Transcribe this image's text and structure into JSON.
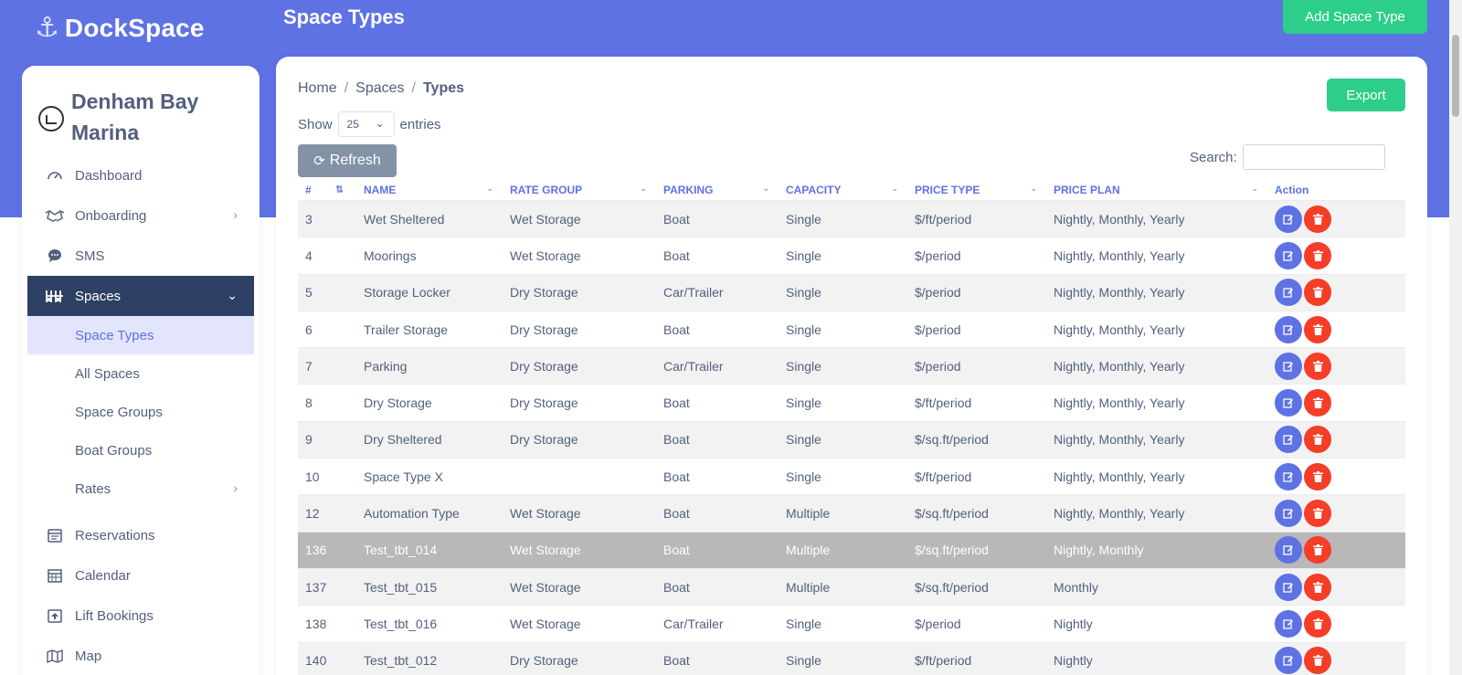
{
  "app": {
    "brand": "DockSpace",
    "page_title": "Space Types",
    "add_button": "Add Space Type"
  },
  "colors": {
    "primary": "#5e72e4",
    "success": "#2dce89",
    "danger": "#f53d28",
    "sidebar_active": "#2e4063"
  },
  "sidebar": {
    "org_name": "Denham Bay Marina",
    "items": [
      {
        "label": "Dashboard",
        "icon": "gauge-icon"
      },
      {
        "label": "Onboarding",
        "icon": "handshake-icon",
        "has_children": true
      },
      {
        "label": "SMS",
        "icon": "chat-icon"
      },
      {
        "label": "Spaces",
        "icon": "spaces-icon",
        "has_children": true,
        "active": true
      },
      {
        "label": "Reservations",
        "icon": "reservations-icon"
      },
      {
        "label": "Calendar",
        "icon": "calendar-icon"
      },
      {
        "label": "Lift Bookings",
        "icon": "lift-icon"
      },
      {
        "label": "Map",
        "icon": "map-icon"
      }
    ],
    "space_subitems": [
      {
        "label": "Space Types",
        "active": true
      },
      {
        "label": "All Spaces"
      },
      {
        "label": "Space Groups"
      },
      {
        "label": "Boat Groups"
      },
      {
        "label": "Rates",
        "has_children": true
      }
    ]
  },
  "breadcrumb": {
    "home": "Home",
    "spaces": "Spaces",
    "current": "Types"
  },
  "toolbar": {
    "export": "Export",
    "show": "Show",
    "entries_value": "25",
    "entries": "entries",
    "refresh": "Refresh",
    "search_label": "Search:",
    "search_value": ""
  },
  "table": {
    "headers": {
      "id": "#",
      "name": "NAME",
      "rate_group": "RATE GROUP",
      "parking": "PARKING",
      "capacity": "CAPACITY",
      "price_type": "PRICE TYPE",
      "price_plan": "PRICE PLAN",
      "action": "Action"
    },
    "rows": [
      {
        "id": "3",
        "name": "Wet Sheltered",
        "rate_group": "Wet Storage",
        "parking": "Boat",
        "capacity": "Single",
        "price_type": "$/ft/period",
        "price_plan": "Nightly, Monthly, Yearly"
      },
      {
        "id": "4",
        "name": "Moorings",
        "rate_group": "Wet Storage",
        "parking": "Boat",
        "capacity": "Single",
        "price_type": "$/period",
        "price_plan": "Nightly, Monthly, Yearly"
      },
      {
        "id": "5",
        "name": "Storage Locker",
        "rate_group": "Dry Storage",
        "parking": "Car/Trailer",
        "capacity": "Single",
        "price_type": "$/period",
        "price_plan": "Nightly, Monthly, Yearly"
      },
      {
        "id": "6",
        "name": "Trailer Storage",
        "rate_group": "Dry Storage",
        "parking": "Boat",
        "capacity": "Single",
        "price_type": "$/period",
        "price_plan": "Nightly, Monthly, Yearly"
      },
      {
        "id": "7",
        "name": "Parking",
        "rate_group": "Dry Storage",
        "parking": "Car/Trailer",
        "capacity": "Single",
        "price_type": "$/period",
        "price_plan": "Nightly, Monthly, Yearly"
      },
      {
        "id": "8",
        "name": "Dry Storage",
        "rate_group": "Dry Storage",
        "parking": "Boat",
        "capacity": "Single",
        "price_type": "$/ft/period",
        "price_plan": "Nightly, Monthly, Yearly"
      },
      {
        "id": "9",
        "name": "Dry Sheltered",
        "rate_group": "Dry Storage",
        "parking": "Boat",
        "capacity": "Single",
        "price_type": "$/sq.ft/period",
        "price_plan": "Nightly, Monthly, Yearly"
      },
      {
        "id": "10",
        "name": "Space Type X",
        "rate_group": "",
        "parking": "Boat",
        "capacity": "Single",
        "price_type": "$/ft/period",
        "price_plan": "Nightly, Monthly, Yearly"
      },
      {
        "id": "12",
        "name": "Automation Type",
        "rate_group": "Wet Storage",
        "parking": "Boat",
        "capacity": "Multiple",
        "price_type": "$/sq.ft/period",
        "price_plan": "Nightly, Monthly, Yearly"
      },
      {
        "id": "136",
        "name": "Test_tbt_014",
        "rate_group": "Wet Storage",
        "parking": "Boat",
        "capacity": "Multiple",
        "price_type": "$/sq.ft/period",
        "price_plan": "Nightly, Monthly",
        "selected": true
      },
      {
        "id": "137",
        "name": "Test_tbt_015",
        "rate_group": "Wet Storage",
        "parking": "Boat",
        "capacity": "Multiple",
        "price_type": "$/sq.ft/period",
        "price_plan": "Monthly"
      },
      {
        "id": "138",
        "name": "Test_tbt_016",
        "rate_group": "Wet Storage",
        "parking": "Car/Trailer",
        "capacity": "Single",
        "price_type": "$/period",
        "price_plan": "Nightly"
      },
      {
        "id": "140",
        "name": "Test_tbt_012",
        "rate_group": "Dry Storage",
        "parking": "Boat",
        "capacity": "Single",
        "price_type": "$/ft/period",
        "price_plan": "Nightly"
      }
    ]
  }
}
